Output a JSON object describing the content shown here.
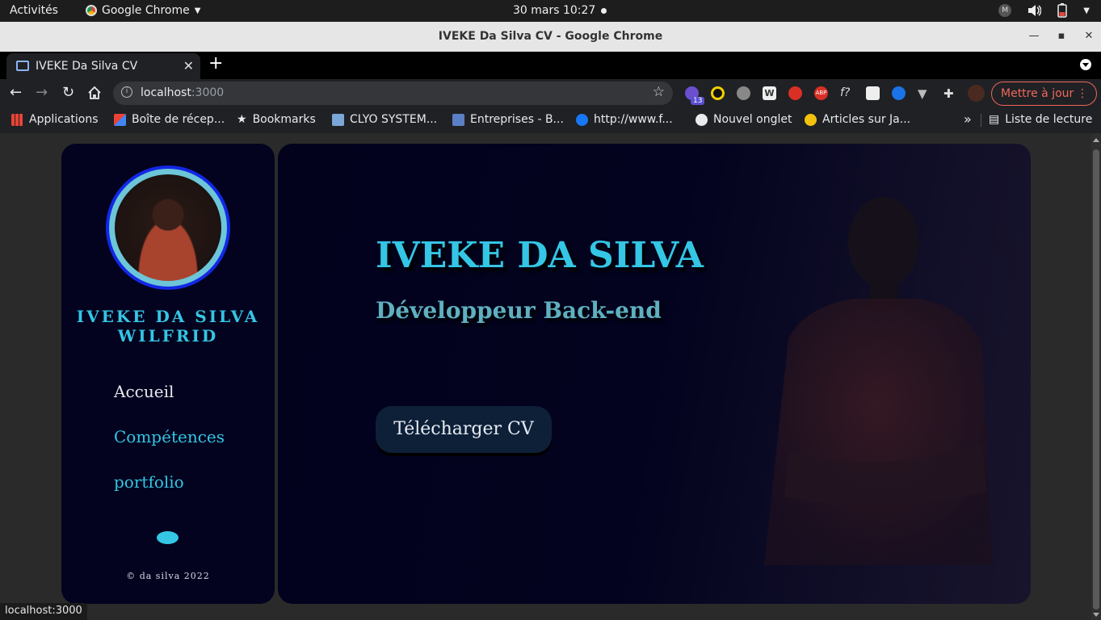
{
  "topbar": {
    "activities": "Activités",
    "app_menu": "Google Chrome",
    "clock": "30 mars  10:27",
    "tray_m": "M"
  },
  "window": {
    "title": "IVEKE Da Silva CV - Google Chrome"
  },
  "tab": {
    "label": "IVEKE Da Silva CV"
  },
  "omnibox": {
    "host": "localhost",
    "port": ":3000"
  },
  "extensions": {
    "badge": "13",
    "wiki": "W",
    "abp": "ABP",
    "fx": "f?"
  },
  "update_button": "Mettre à jour",
  "bookmarks": [
    {
      "label": "Applications",
      "icon": "apps-grid-icon",
      "color": "#4285f4"
    },
    {
      "label": "Boîte de récep...",
      "icon": "gmail-icon",
      "color": "#ea4335"
    },
    {
      "label": "Bookmarks",
      "icon": "star-icon",
      "color": "#e8eaed"
    },
    {
      "label": "CLYO SYSTEM...",
      "icon": "clyo-icon",
      "color": "#7aa7d8"
    },
    {
      "label": "Entreprises - B...",
      "icon": "doc-icon",
      "color": "#5b7fc4"
    },
    {
      "label": "http://www.f...",
      "icon": "facebook-icon",
      "color": "#1877f2"
    },
    {
      "label": "Nouvel onglet",
      "icon": "globe-icon",
      "color": "#e8eaed"
    },
    {
      "label": "Articles sur Ja...",
      "icon": "articles-icon",
      "color": "#f4c20d"
    }
  ],
  "reading_list": "Liste de lecture",
  "sidebar": {
    "name": "IVEKE DA SILVA WILFRID",
    "nav": [
      "Accueil",
      "Compétences",
      "portfolio"
    ],
    "copyright": "© da silva 2022"
  },
  "hero": {
    "title": "IVEKE DA SILVA",
    "subtitle": "Développeur Back-end",
    "cta": "Télécharger CV"
  },
  "status_url": "localhost:3000",
  "colors": {
    "accent": "#34c6e4",
    "card_bg": "#03031f",
    "update": "#ee675c"
  }
}
